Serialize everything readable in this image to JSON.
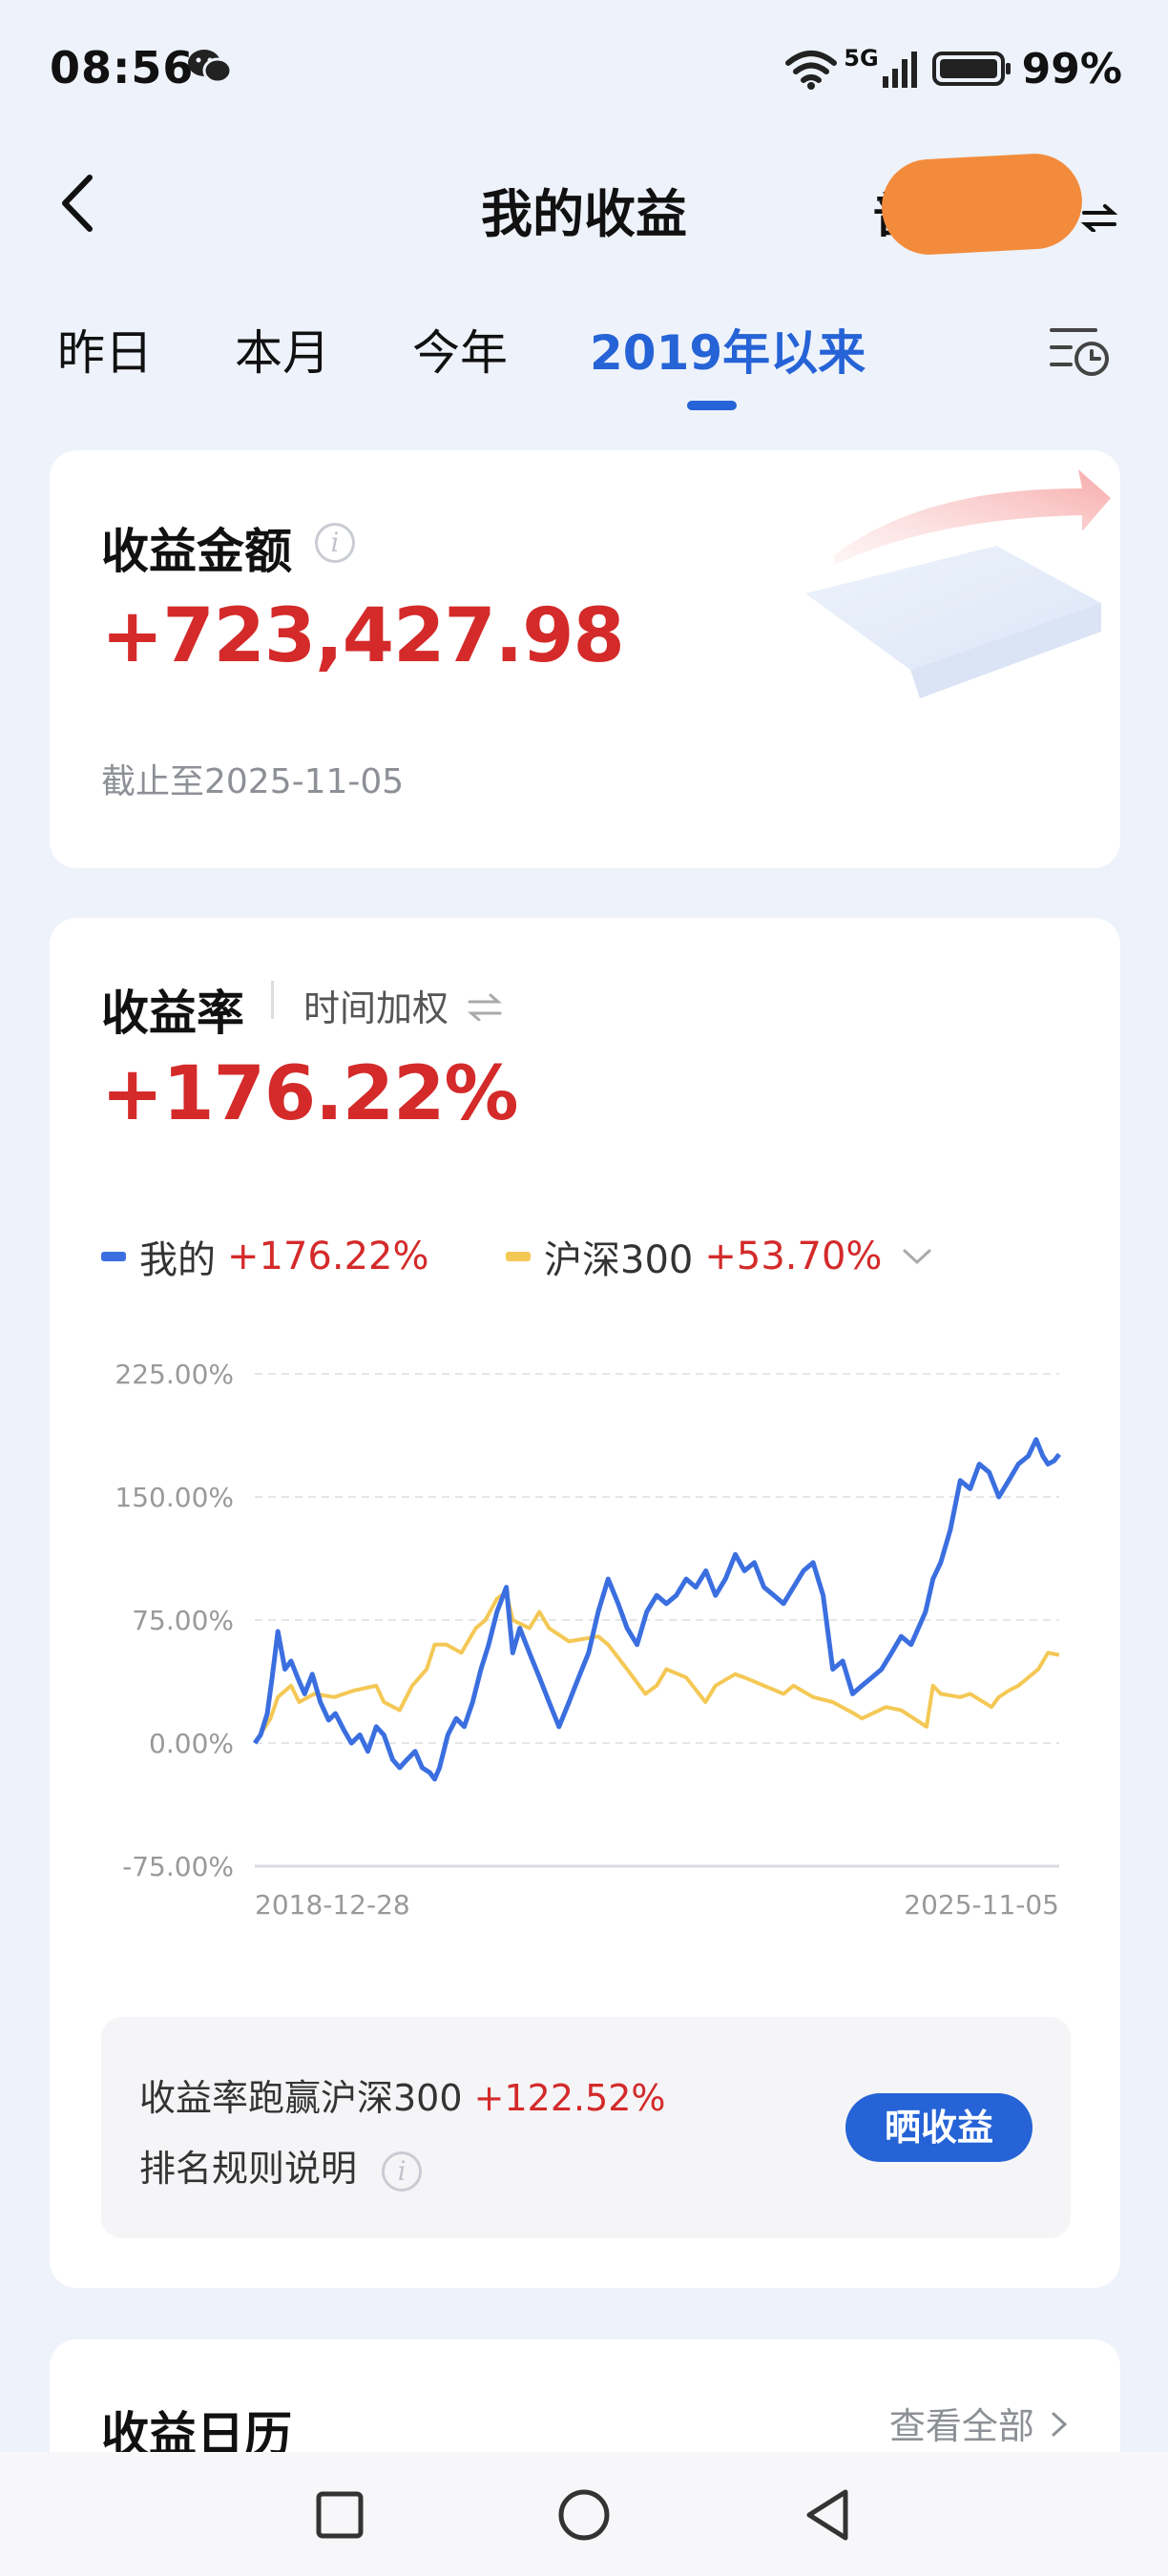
{
  "status_bar": {
    "time": "08:56",
    "network": "5G",
    "battery": "99%"
  },
  "header": {
    "title": "我的收益",
    "account_label": "普"
  },
  "tabs": [
    {
      "label": "昨日",
      "active": false
    },
    {
      "label": "本月",
      "active": false
    },
    {
      "label": "今年",
      "active": false
    },
    {
      "label": "2019年以来",
      "active": true
    }
  ],
  "earnings": {
    "title": "收益金额",
    "amount": "+723,427.98",
    "as_of": "截止至2025-11-05"
  },
  "rate": {
    "title": "收益率",
    "method": "时间加权",
    "value": "+176.22%",
    "legend": [
      {
        "label": "我的",
        "value": "+176.22%",
        "color": "#3b6fe0"
      },
      {
        "label": "沪深300",
        "value": "+53.70%",
        "color": "#f4c855"
      }
    ]
  },
  "chart_data": {
    "type": "line",
    "y_ticks": [
      "225.00%",
      "150.00%",
      "75.00%",
      "0.00%",
      "-75.00%"
    ],
    "x_ticks": [
      "2018-12-28",
      "2025-11-05"
    ],
    "ylim": [
      -75,
      225
    ],
    "xlim": [
      "2018-12-28",
      "2025-11-05"
    ],
    "grid": true,
    "series": [
      {
        "name": "我的",
        "color": "#3b6fe0",
        "x": [
          "2018-12-28",
          "2019-01-15",
          "2019-02-05",
          "2019-02-20",
          "2019-03-10",
          "2019-04-01",
          "2019-04-20",
          "2019-05-10",
          "2019-06-01",
          "2019-06-25",
          "2019-07-20",
          "2019-08-15",
          "2019-09-05",
          "2019-10-01",
          "2019-10-25",
          "2019-11-20",
          "2019-12-15",
          "2020-01-10",
          "2020-02-03",
          "2020-03-01",
          "2020-03-23",
          "2020-04-15",
          "2020-05-10",
          "2020-06-01",
          "2020-06-25",
          "2020-07-10",
          "2020-07-25",
          "2020-08-20",
          "2020-09-15",
          "2020-10-10",
          "2020-11-05",
          "2020-12-01",
          "2020-12-25",
          "2021-01-20",
          "2021-02-18",
          "2021-03-10",
          "2021-04-01",
          "2021-05-01",
          "2021-06-01",
          "2021-07-01",
          "2021-08-01",
          "2021-09-01",
          "2021-10-01",
          "2021-11-01",
          "2021-12-01",
          "2022-01-01",
          "2022-02-01",
          "2022-03-01",
          "2022-04-01",
          "2022-05-01",
          "2022-06-01",
          "2022-07-01",
          "2022-08-01",
          "2022-09-01",
          "2022-10-01",
          "2022-11-01",
          "2022-12-01",
          "2023-01-01",
          "2023-02-01",
          "2023-03-01",
          "2023-04-01",
          "2023-05-01",
          "2023-06-01",
          "2023-07-01",
          "2023-08-01",
          "2023-09-01",
          "2023-10-01",
          "2023-11-01",
          "2023-12-01",
          "2024-01-01",
          "2024-02-01",
          "2024-03-01",
          "2024-04-01",
          "2024-05-01",
          "2024-06-01",
          "2024-07-01",
          "2024-08-01",
          "2024-09-15",
          "2024-10-08",
          "2024-11-01",
          "2024-12-01",
          "2025-01-01",
          "2025-02-01",
          "2025-03-01",
          "2025-04-01",
          "2025-05-01",
          "2025-06-01",
          "2025-07-01",
          "2025-08-01",
          "2025-08-25",
          "2025-09-15",
          "2025-10-01",
          "2025-10-20",
          "2025-11-05"
        ],
        "y": [
          0,
          5,
          18,
          40,
          68,
          45,
          50,
          40,
          30,
          42,
          25,
          14,
          18,
          8,
          0,
          5,
          -5,
          10,
          5,
          -10,
          -15,
          -10,
          -5,
          -15,
          -18,
          -22,
          -15,
          5,
          15,
          10,
          25,
          45,
          60,
          80,
          95,
          55,
          70,
          55,
          40,
          25,
          10,
          25,
          40,
          55,
          80,
          100,
          85,
          70,
          60,
          80,
          90,
          85,
          90,
          100,
          95,
          105,
          90,
          100,
          115,
          105,
          110,
          95,
          90,
          85,
          95,
          105,
          110,
          90,
          45,
          50,
          30,
          35,
          40,
          45,
          55,
          65,
          60,
          80,
          100,
          110,
          130,
          160,
          155,
          170,
          165,
          150,
          160,
          170,
          175,
          185,
          175,
          170,
          172,
          176
        ]
      },
      {
        "name": "沪深300",
        "color": "#f4c855",
        "x": [
          "2018-12-28",
          "2019-02-15",
          "2019-03-10",
          "2019-04-20",
          "2019-05-15",
          "2019-07-01",
          "2019-09-01",
          "2019-11-01",
          "2020-01-10",
          "2020-02-03",
          "2020-03-23",
          "2020-05-01",
          "2020-06-15",
          "2020-07-10",
          "2020-08-15",
          "2020-10-01",
          "2020-11-15",
          "2020-12-15",
          "2021-01-20",
          "2021-02-18",
          "2021-03-10",
          "2021-05-01",
          "2021-06-01",
          "2021-07-01",
          "2021-09-01",
          "2021-12-01",
          "2022-01-01",
          "2022-03-01",
          "2022-04-27",
          "2022-06-01",
          "2022-07-01",
          "2022-09-01",
          "2022-10-31",
          "2022-12-01",
          "2023-01-31",
          "2023-03-01",
          "2023-05-01",
          "2023-07-01",
          "2023-08-01",
          "2023-10-01",
          "2023-12-01",
          "2024-02-05",
          "2024-03-01",
          "2024-05-15",
          "2024-07-01",
          "2024-09-18",
          "2024-10-08",
          "2024-11-01",
          "2025-01-01",
          "2025-02-01",
          "2025-04-08",
          "2025-05-01",
          "2025-06-01",
          "2025-07-01",
          "2025-08-01",
          "2025-09-01",
          "2025-10-01",
          "2025-11-05"
        ],
        "y": [
          0,
          15,
          28,
          35,
          25,
          30,
          28,
          32,
          35,
          25,
          20,
          35,
          45,
          60,
          60,
          55,
          70,
          75,
          88,
          92,
          75,
          70,
          80,
          70,
          62,
          65,
          60,
          45,
          30,
          35,
          45,
          40,
          25,
          35,
          42,
          40,
          35,
          30,
          35,
          28,
          25,
          18,
          15,
          22,
          20,
          10,
          35,
          30,
          28,
          30,
          22,
          28,
          32,
          35,
          40,
          45,
          55,
          53.7
        ]
      }
    ]
  },
  "compare": {
    "text": "收益率跑赢沪深300",
    "value": "+122.52%",
    "rule": "排名规则说明",
    "share_button": "晒收益"
  },
  "calendar": {
    "title": "收益日历",
    "see_all": "查看全部"
  },
  "colors": {
    "accent": "#2563d6",
    "positive": "#d42a2a",
    "background": "#eef2fa"
  }
}
